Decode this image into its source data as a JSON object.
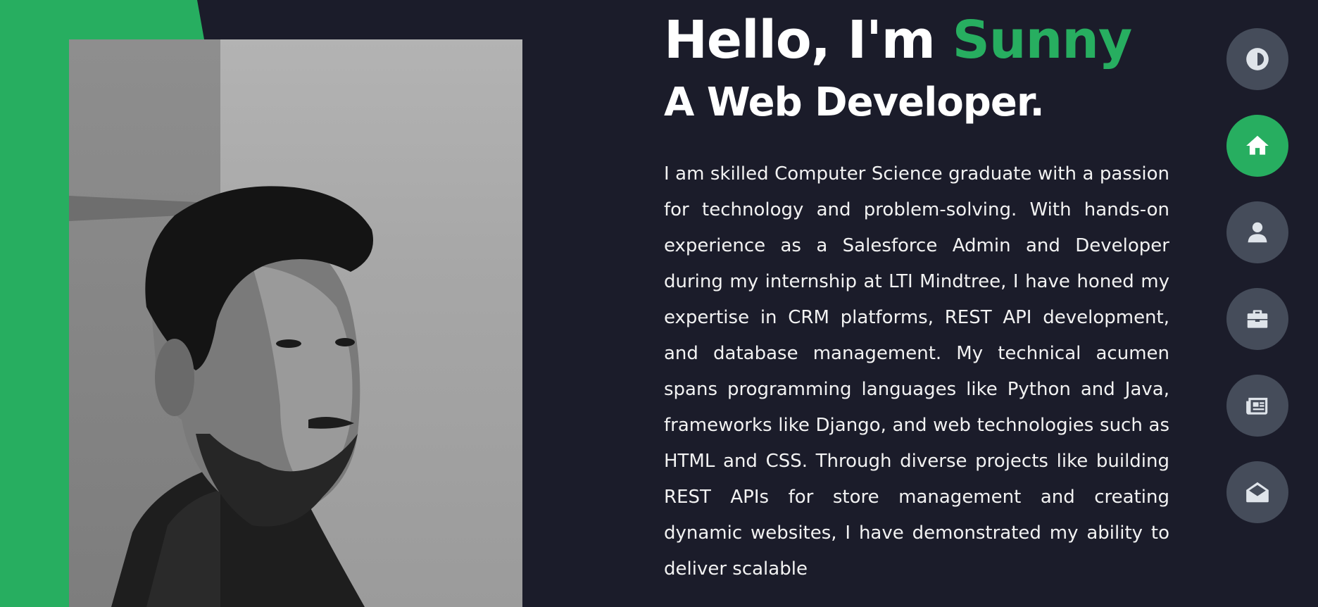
{
  "hero": {
    "greeting": "Hello, I'm",
    "name": "Sunny",
    "role": "A Web Developer.",
    "bio": "I am skilled Computer Science graduate with a passion for technology and problem-solving. With hands-on experience as a Salesforce Admin and Developer during my internship at LTI Mindtree, I have honed my expertise in CRM platforms, REST API development, and database management. My technical acumen spans programming languages like Python and Java, frameworks like Django, and web technologies such as HTML and CSS. Through diverse projects like building REST APIs for store management and creating dynamic websites, I have demonstrated my ability to deliver scalable"
  },
  "colors": {
    "accent": "#27ae60",
    "background": "#1b1c2a",
    "nav_button": "#454c5a"
  },
  "nav": {
    "items": [
      {
        "icon": "theme-toggle-icon",
        "active": false
      },
      {
        "icon": "home-icon",
        "active": true
      },
      {
        "icon": "user-icon",
        "active": false
      },
      {
        "icon": "briefcase-icon",
        "active": false
      },
      {
        "icon": "newspaper-icon",
        "active": false
      },
      {
        "icon": "envelope-open-icon",
        "active": false
      }
    ]
  }
}
